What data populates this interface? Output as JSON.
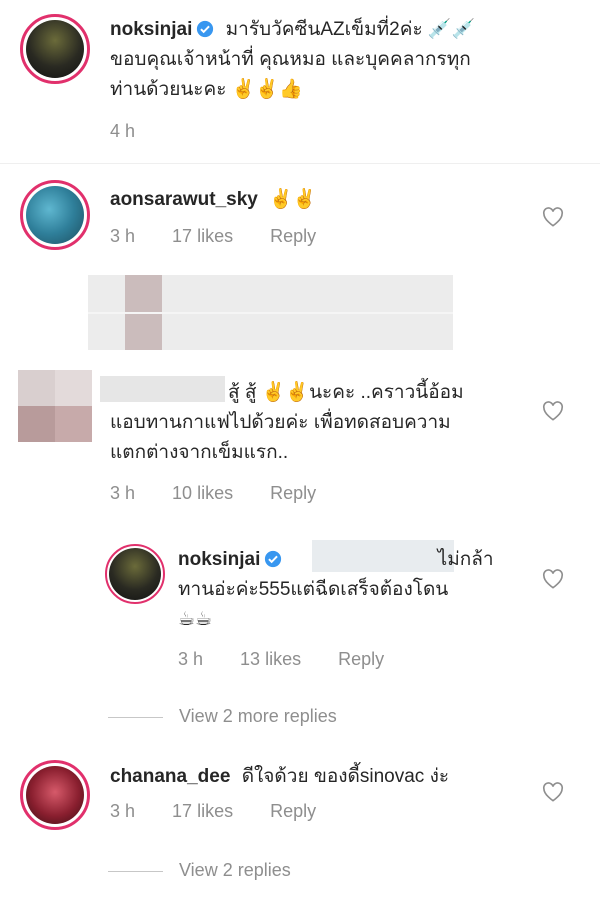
{
  "post": {
    "username": "noksinjai",
    "caption_line1": "มารับวัคซีนAZเข็มที่2ค่ะ 💉💉",
    "caption_line2": "ขอบคุณเจ้าหน้าที่ คุณหมอ และบุคคลากรทุก",
    "caption_line3": "ท่านด้วยนะคะ ✌️✌️👍",
    "time": "4 h"
  },
  "comments": [
    {
      "username": "aonsarawut_sky",
      "text": "✌️✌️",
      "time": "3 h",
      "likes": "17 likes",
      "reply_label": "Reply"
    },
    {
      "username": "",
      "line1": "สู้ สู้ ✌️✌️นะคะ ..คราวนี้อ้อม",
      "line2": "แอบทานกาแฟไปด้วยค่ะ เพื่อทดสอบความ",
      "line3": "แตกต่างจากเข็มแรก..",
      "time": "3 h",
      "likes": "10 likes",
      "reply_label": "Reply"
    },
    {
      "username": "chanana_dee",
      "text": "ดีใจด้วย ของดี้sinovac ง่ะ",
      "time": "3 h",
      "likes": "17 likes",
      "reply_label": "Reply"
    }
  ],
  "reply": {
    "username": "noksinjai",
    "line1_suffix": "ไม่กล้า",
    "line2": "ทานอ่ะค่ะ555แต่ฉีดเสร็จต้องโดน",
    "line3": "☕☕",
    "time": "3 h",
    "likes": "13 likes",
    "reply_label": "Reply"
  },
  "view_more_replies": "View 2 more replies",
  "view_replies": "View 2 replies",
  "colors": {
    "verified": "#3897f0",
    "meta": "#8e8e8e",
    "story_ring": "#e1306c"
  }
}
